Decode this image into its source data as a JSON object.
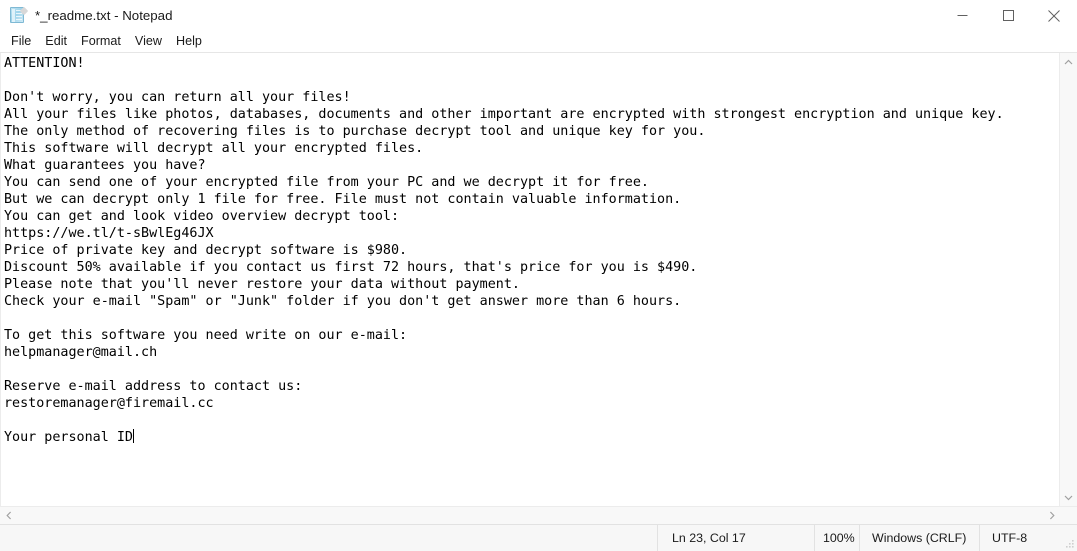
{
  "window": {
    "title": "*_readme.txt - Notepad",
    "icon": "notepad-icon",
    "controls": {
      "minimize": "minimize-icon",
      "maximize": "maximize-icon",
      "close": "close-icon"
    }
  },
  "menubar": {
    "items": [
      {
        "label": "File"
      },
      {
        "label": "Edit"
      },
      {
        "label": "Format"
      },
      {
        "label": "View"
      },
      {
        "label": "Help"
      }
    ]
  },
  "document": {
    "lines": [
      "ATTENTION!",
      "",
      "Don't worry, you can return all your files!",
      "All your files like photos, databases, documents and other important are encrypted with strongest encryption and unique key.",
      "The only method of recovering files is to purchase decrypt tool and unique key for you.",
      "This software will decrypt all your encrypted files.",
      "What guarantees you have?",
      "You can send one of your encrypted file from your PC and we decrypt it for free.",
      "But we can decrypt only 1 file for free. File must not contain valuable information.",
      "You can get and look video overview decrypt tool:",
      "https://we.tl/t-sBwlEg46JX",
      "Price of private key and decrypt software is $980.",
      "Discount 50% available if you contact us first 72 hours, that's price for you is $490.",
      "Please note that you'll never restore your data without payment.",
      "Check your e-mail \"Spam\" or \"Junk\" folder if you don't get answer more than 6 hours.",
      "",
      "To get this software you need write on our e-mail:",
      "helpmanager@mail.ch",
      "",
      "Reserve e-mail address to contact us:",
      "restoremanager@firemail.cc",
      "",
      "Your personal ID"
    ],
    "caret_line": "Your personal ID"
  },
  "scrollbars": {
    "vertical": {
      "up": "chevron-up-icon",
      "down": "chevron-down-icon"
    },
    "horizontal": {
      "left": "chevron-left-icon",
      "right": "chevron-right-icon"
    }
  },
  "statusbar": {
    "position": "Ln 23, Col 17",
    "zoom": "100%",
    "line_endings": "Windows (CRLF)",
    "encoding": "UTF-8"
  },
  "colors": {
    "window_bg": "#ffffff",
    "text": "#000000",
    "statusbar_bg": "#f7f7f7",
    "scrollbar_bg": "#f8f8f8",
    "border": "#e2e2e2"
  }
}
